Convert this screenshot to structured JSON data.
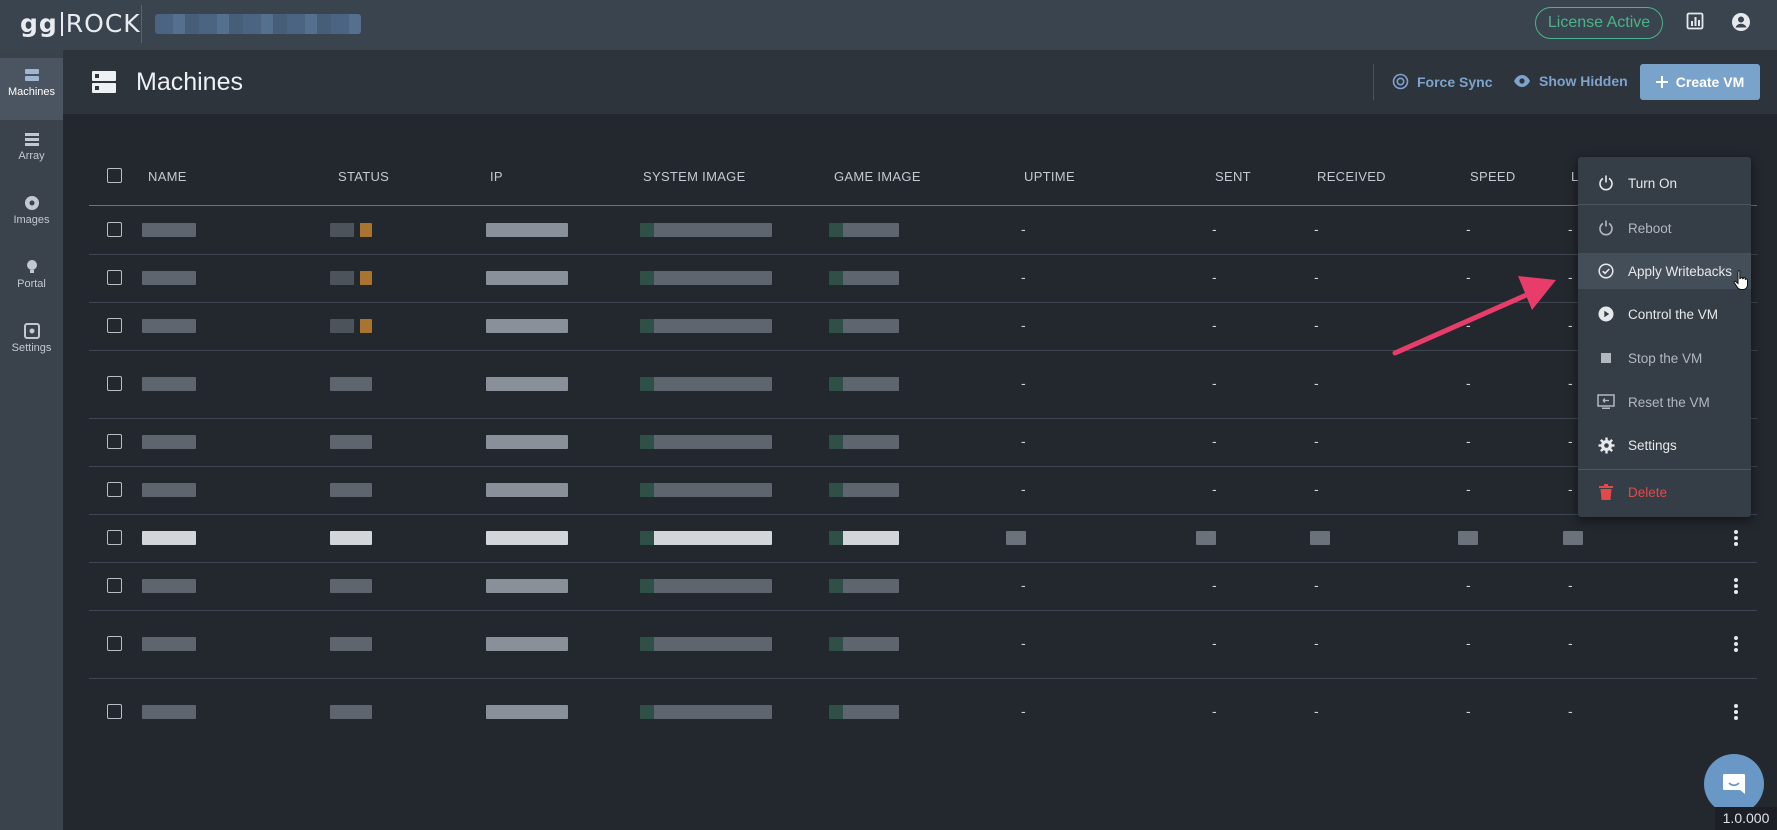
{
  "app": {
    "logo_left": "gg",
    "logo_right": "ROCK",
    "license_label": "License Active"
  },
  "sidebar": {
    "items": [
      {
        "label": "Machines",
        "icon": "server-icon",
        "active": true
      },
      {
        "label": "Array",
        "icon": "array-icon"
      },
      {
        "label": "Images",
        "icon": "disc-icon"
      },
      {
        "label": "Portal",
        "icon": "bulb-icon"
      },
      {
        "label": "Settings",
        "icon": "settings-icon"
      }
    ]
  },
  "header": {
    "title": "Machines",
    "force_sync_label": "Force Sync",
    "show_hidden_label": "Show Hidden",
    "create_vm_label": "Create VM"
  },
  "table": {
    "columns": [
      "NAME",
      "STATUS",
      "IP",
      "SYSTEM IMAGE",
      "GAME IMAGE",
      "UPTIME",
      "SENT",
      "RECEIVED",
      "SPEED",
      "L"
    ],
    "empty_value": "-"
  },
  "context_menu": {
    "items": [
      {
        "label": "Turn On",
        "icon": "power-icon"
      },
      {
        "label": "Reboot",
        "icon": "reboot-icon"
      },
      {
        "label": "Apply Writebacks",
        "icon": "check-circle-icon"
      },
      {
        "label": "Control the VM",
        "icon": "play-circle-icon"
      },
      {
        "label": "Stop the VM",
        "icon": "stop-icon"
      },
      {
        "label": "Reset the VM",
        "icon": "reset-screen-icon"
      },
      {
        "label": "Settings",
        "icon": "gear-icon"
      },
      {
        "label": "Delete",
        "icon": "trash-icon"
      }
    ]
  },
  "footer": {
    "version": "1.0.000"
  },
  "colors": {
    "accent": "#7aa3cb",
    "license": "#4bb38a",
    "danger": "#e24a4a",
    "annotation_arrow": "#e83c6a"
  }
}
